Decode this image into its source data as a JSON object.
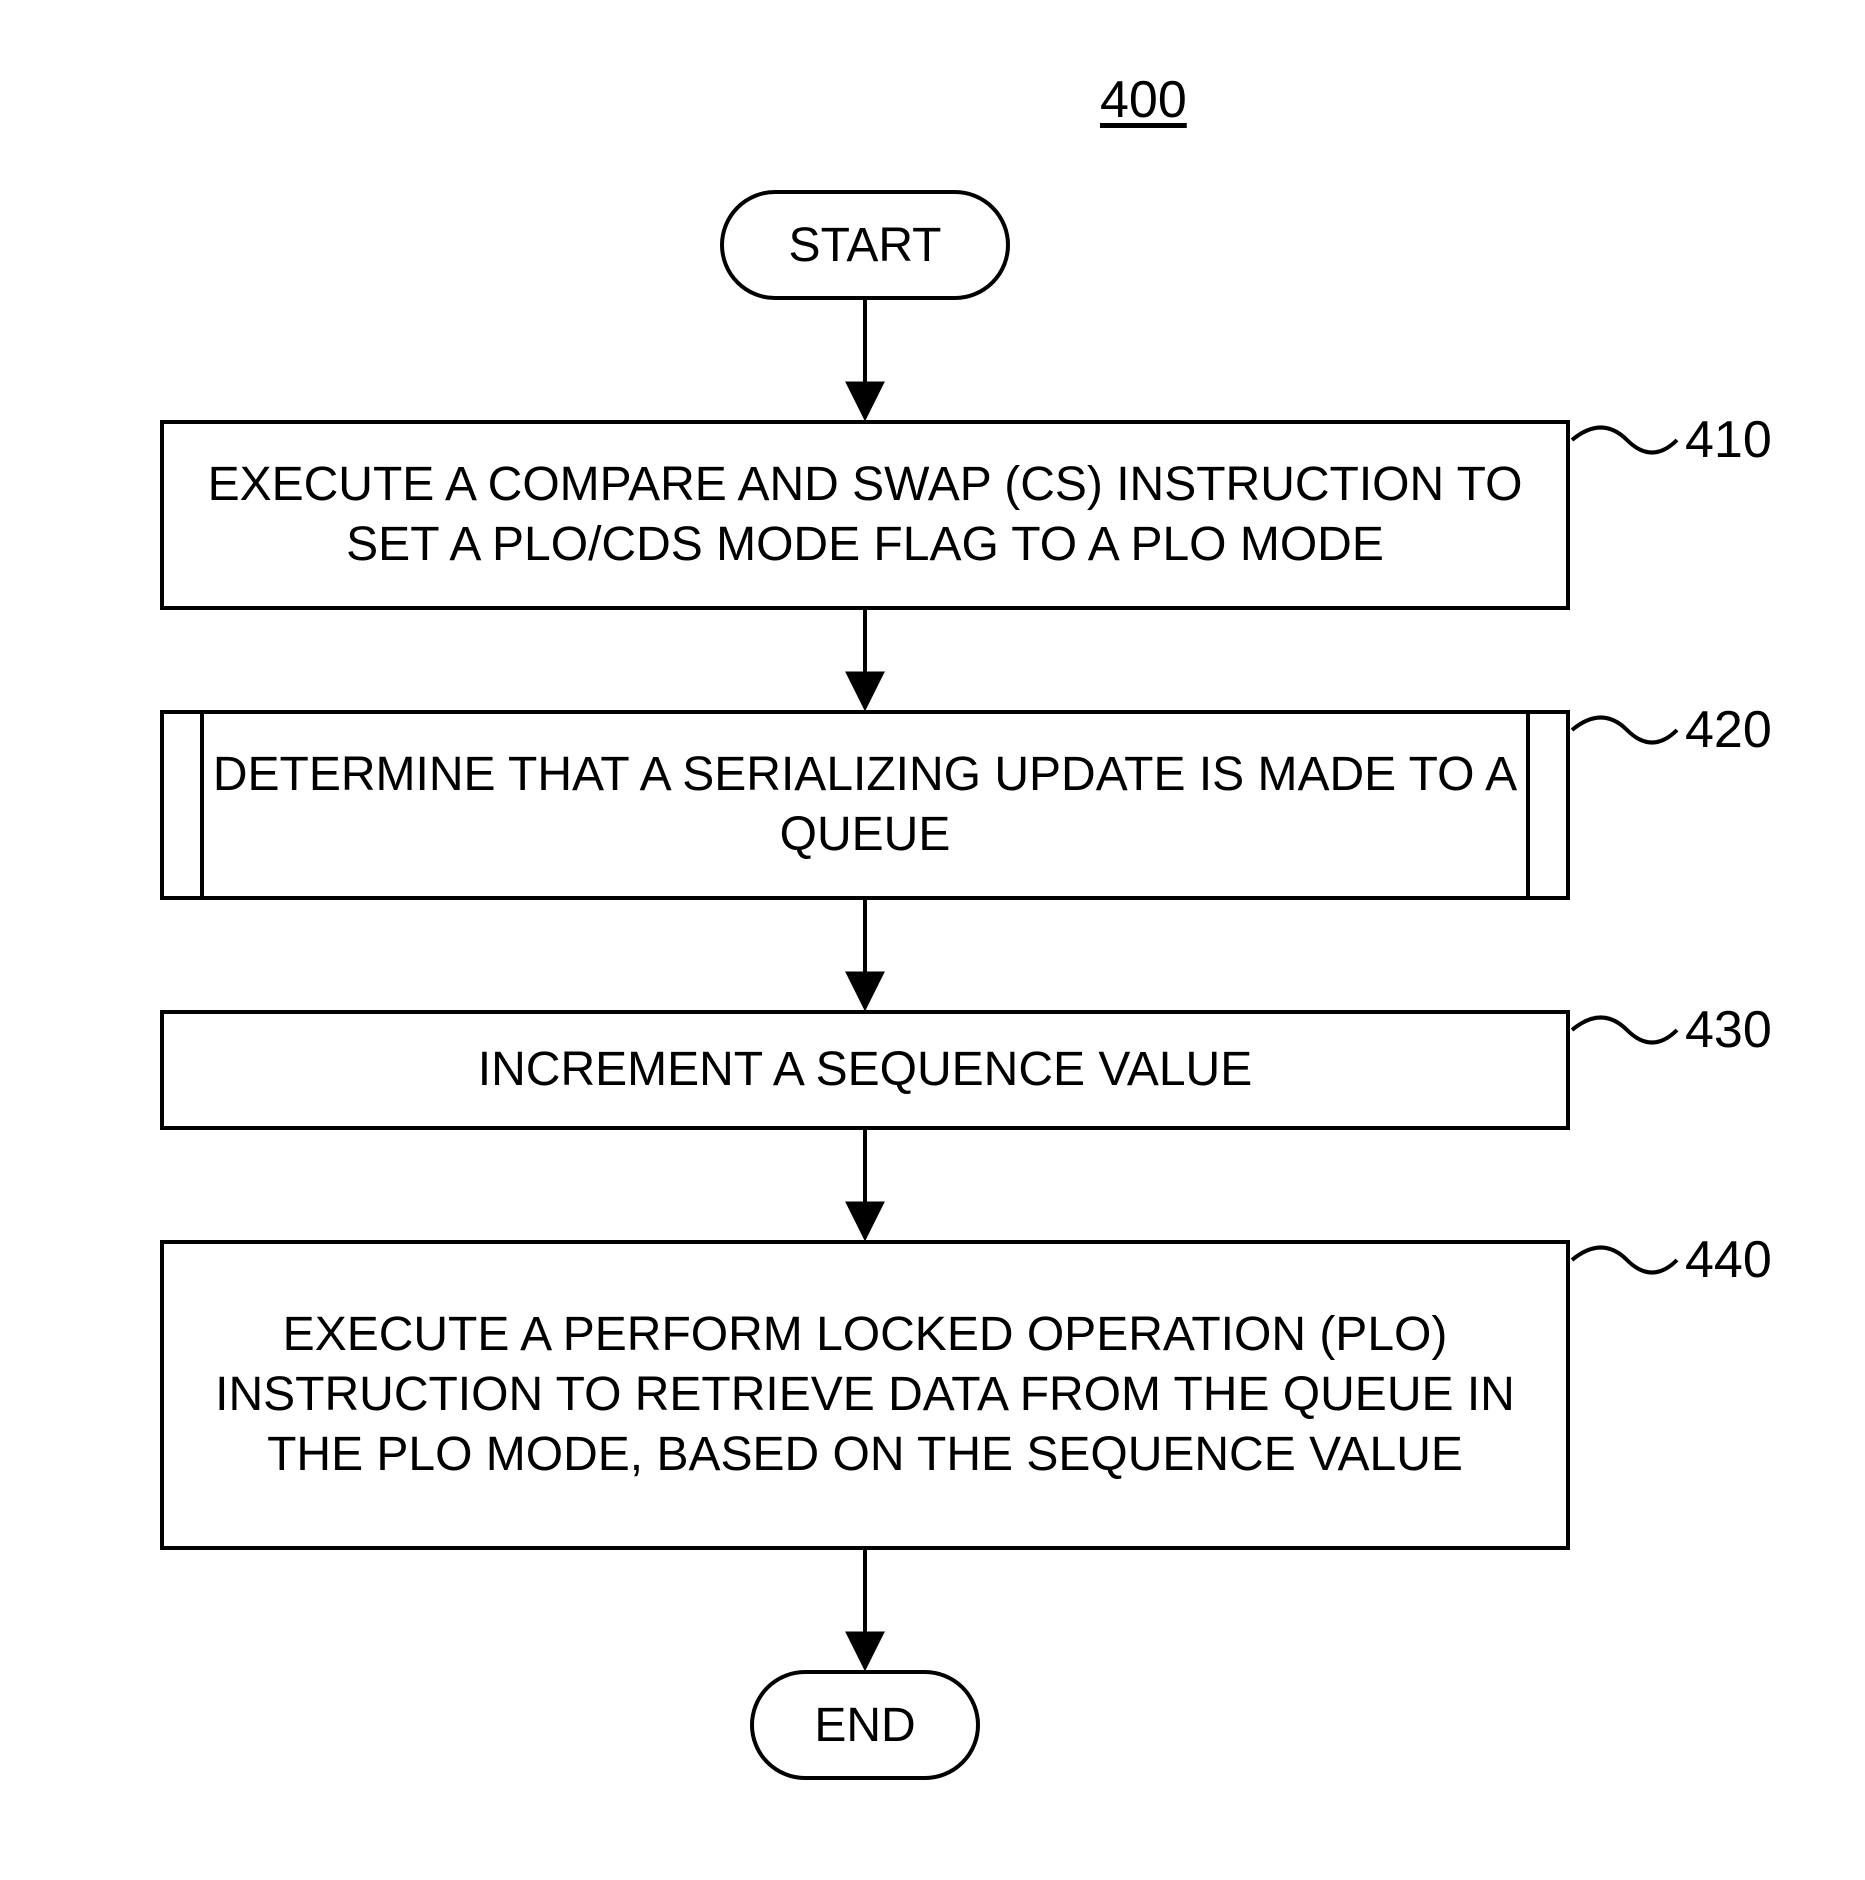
{
  "figure_id": "400",
  "terminators": {
    "start": "START",
    "end": "END"
  },
  "steps": [
    {
      "ref": "410",
      "text": "EXECUTE A COMPARE AND SWAP (CS) INSTRUCTION TO SET A PLO/CDS MODE FLAG TO A PLO MODE"
    },
    {
      "ref": "420",
      "text": "DETERMINE THAT A SERIALIZING UPDATE IS MADE TO A QUEUE"
    },
    {
      "ref": "430",
      "text": "INCREMENT A SEQUENCE VALUE"
    },
    {
      "ref": "440",
      "text": "EXECUTE A PERFORM LOCKED OPERATION (PLO) INSTRUCTION TO RETRIEVE DATA FROM THE QUEUE IN THE PLO MODE, BASED ON THE SEQUENCE VALUE"
    }
  ]
}
